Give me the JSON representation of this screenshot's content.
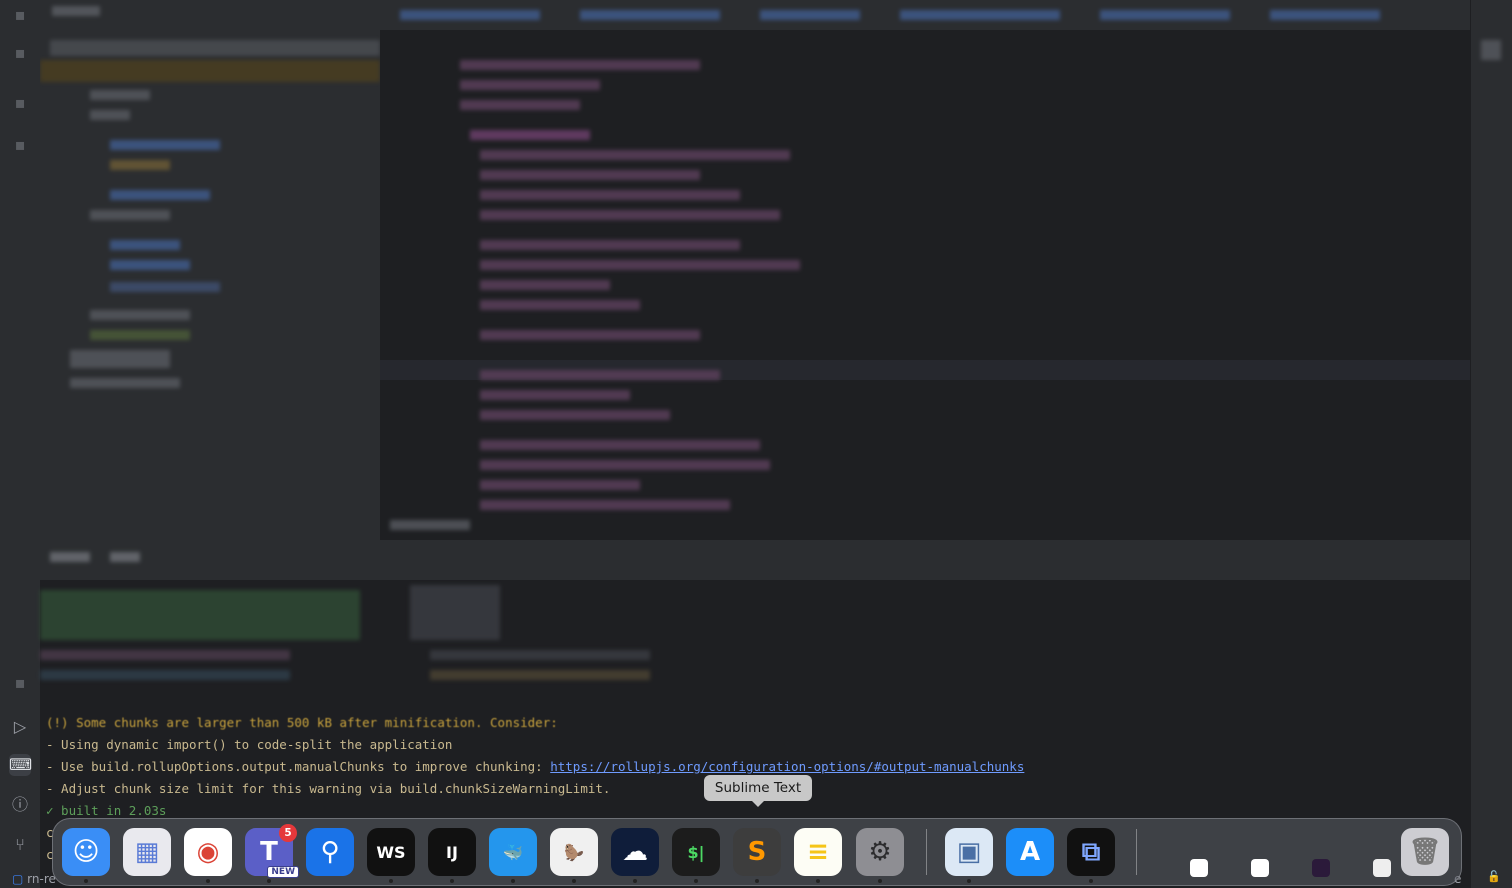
{
  "tooltip": {
    "label": "Sublime Text"
  },
  "terminal": {
    "warning_line": "(!) Some chunks are larger than 500 kB after minification. Consider:",
    "line1": "- Using dynamic import() to code-split the application",
    "line2_prefix": "- Use build.rollupOptions.output.manualChunks to improve chunking:",
    "line2_link": "https://rollupjs.org/configuration-options/#output-manualchunks",
    "line3": "- Adjust chunk size limit for this warning via build.chunkSizeWarningLimit.",
    "line4": "✓ built in 2.03s",
    "line5_partial": "c",
    "line6_partial": "c"
  },
  "status_bar": {
    "project_label": "rn-re",
    "right_partial": "e"
  },
  "dock": {
    "teams_badge": "5",
    "teams_tag": "NEW",
    "apps": [
      {
        "name": "Finder",
        "icon": "finder-icon",
        "glyph": "☺",
        "bg": "#3a8ef6",
        "fg": "#ffffff"
      },
      {
        "name": "Launchpad",
        "icon": "launchpad-icon",
        "glyph": "▦",
        "bg": "#e9e9ee",
        "fg": "#5a7bd6"
      },
      {
        "name": "Google Chrome",
        "icon": "chrome-icon",
        "glyph": "◉",
        "bg": "#ffffff",
        "fg": "#db4437"
      },
      {
        "name": "Microsoft Teams",
        "icon": "teams-icon",
        "glyph": "T",
        "bg": "#5b5fc7",
        "fg": "#ffffff"
      },
      {
        "name": "1Password",
        "icon": "password-icon",
        "glyph": "⚲",
        "bg": "#1a73e8",
        "fg": "#ffffff"
      },
      {
        "name": "WebStorm",
        "icon": "webstorm-icon",
        "glyph": "WS",
        "bg": "#111111",
        "fg": "#ffffff"
      },
      {
        "name": "IntelliJ IDEA",
        "icon": "intellij-icon",
        "glyph": "IJ",
        "bg": "#111111",
        "fg": "#ffffff"
      },
      {
        "name": "Docker",
        "icon": "docker-icon",
        "glyph": "🐳",
        "bg": "#2496ed",
        "fg": "#ffffff"
      },
      {
        "name": "DBeaver",
        "icon": "dbeaver-icon",
        "glyph": "🦫",
        "bg": "#f0f0f0",
        "fg": "#333333"
      },
      {
        "name": "Cloud Shell",
        "icon": "cloud-shell-icon",
        "glyph": "☁",
        "bg": "#0f1d3a",
        "fg": "#ffffff"
      },
      {
        "name": "Terminal",
        "icon": "terminal-icon",
        "glyph": "$|",
        "bg": "#1c1c1c",
        "fg": "#4cd964"
      },
      {
        "name": "Sublime Text",
        "icon": "sublime-icon",
        "glyph": "S",
        "bg": "#3d3d3d",
        "fg": "#ff9800"
      },
      {
        "name": "Notes",
        "icon": "notes-icon",
        "glyph": "≡",
        "bg": "#fdfdf5",
        "fg": "#f5c518"
      },
      {
        "name": "System Settings",
        "icon": "settings-icon",
        "glyph": "⚙",
        "bg": "#8e8e93",
        "fg": "#2c2c2e"
      },
      {
        "name": "Preview",
        "icon": "preview-icon",
        "glyph": "▣",
        "bg": "#dce8f5",
        "fg": "#4a6fa5"
      },
      {
        "name": "App Store",
        "icon": "app-store-icon",
        "glyph": "A",
        "bg": "#1c8ef9",
        "fg": "#ffffff"
      },
      {
        "name": "Screen Capture",
        "icon": "screen-capture-icon",
        "glyph": "⧉",
        "bg": "#111111",
        "fg": "#7fa7ff"
      }
    ]
  },
  "colors": {
    "editor_bg": "#1e1f22",
    "panel_bg": "#2b2d30",
    "link": "#6f9bff",
    "warning": "#c9a33d",
    "success": "#5d9f5a"
  }
}
